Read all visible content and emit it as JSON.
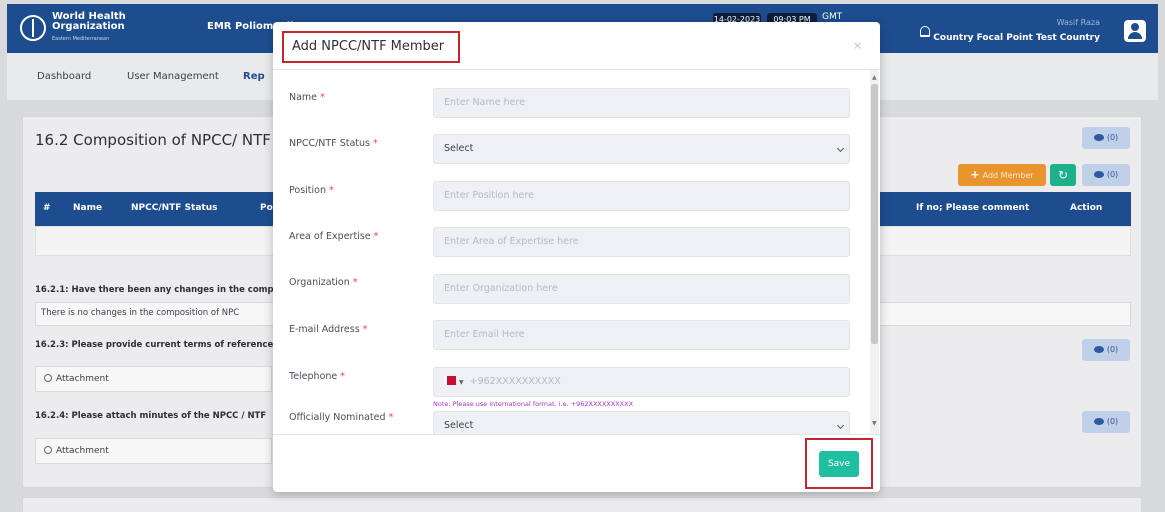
{
  "header": {
    "logo_line1": "World Health",
    "logo_line2": "Organization",
    "logo_line3": "Eastern Mediterranean",
    "app_title": "EMR Poliomyelit",
    "date": "14-02-2023",
    "time": "09:03 PM",
    "timezone": "GMT",
    "user_name": "Wasif Raza",
    "user_role": "Country Focal Point Test Country"
  },
  "nav": {
    "dashboard": "Dashboard",
    "user_management": "User Management",
    "reports": "Rep"
  },
  "page": {
    "section_title": "16.2 Composition of NPCC/ NTF f",
    "comment_count": "(0)",
    "add_member": "Add Member",
    "table_headers": {
      "num": "#",
      "name": "Name",
      "status": "NPCC/NTF Status",
      "position": "Po",
      "comment": "If no; Please comment",
      "action": "Action"
    },
    "q1": "16.2.1: Have there been any changes in the comp",
    "q1_answer": "There is no changes in the composition of NPC",
    "q3": "16.2.3: Please provide current terms of reference",
    "q4": "16.2.4: Please attach minutes of the NPCC / NTF",
    "attachment": "Attachment"
  },
  "modal": {
    "title": "Add NPCC/NTF Member",
    "close": "×",
    "fields": {
      "name": {
        "label": "Name",
        "placeholder": "Enter Name here"
      },
      "status": {
        "label": "NPCC/NTF Status",
        "value": "Select"
      },
      "position": {
        "label": "Position",
        "placeholder": "Enter Position here"
      },
      "expertise": {
        "label": "Area of Expertise",
        "placeholder": "Enter Area of Expertise here"
      },
      "organization": {
        "label": "Organization",
        "placeholder": "Enter Organization here"
      },
      "email": {
        "label": "E-mail Address",
        "placeholder": "Enter Email Here"
      },
      "telephone": {
        "label": "Telephone",
        "placeholder": "+962XXXXXXXXXX"
      },
      "nominated": {
        "label": "Officially Nominated",
        "value": "Select"
      }
    },
    "required_mark": "*",
    "phone_note": "Note: Please use international format. i.e. +962XXXXXXXXXX",
    "save_label": "Save"
  }
}
